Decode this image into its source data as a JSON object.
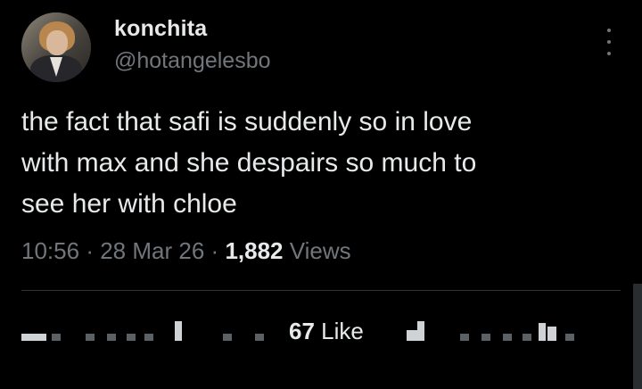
{
  "tweet": {
    "display_name": "konchita",
    "handle": "@hotangelesbo",
    "text": "the fact that safi is suddenly so in love\nwith max and she despairs so much to\nsee her with chloe",
    "time": "10:56",
    "separator": "·",
    "date": "28 Mar 26",
    "views_count": "1,882",
    "views_label": "Views"
  },
  "actions": {
    "likes_count": "67",
    "likes_label": "Like"
  },
  "icons": {
    "avatar": "profile-photo",
    "more": "more-vertical-icon"
  },
  "colors": {
    "background": "#000000",
    "primary_text": "#e7e9ea",
    "secondary_text": "#71767b",
    "divider": "#2f3336"
  }
}
